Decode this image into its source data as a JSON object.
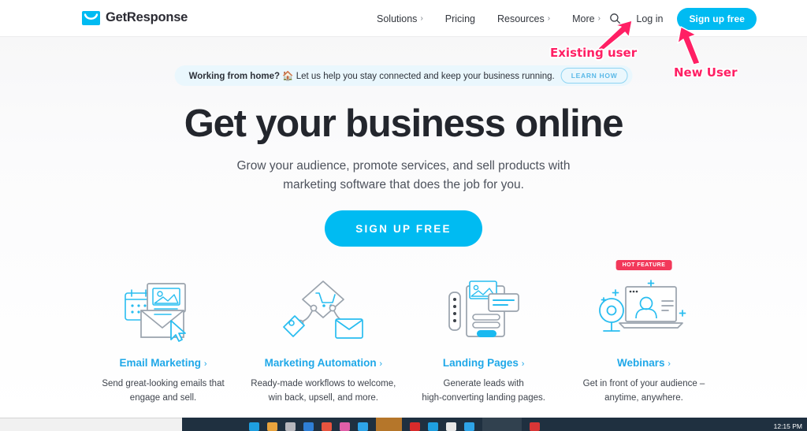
{
  "header": {
    "logo_text": "GetResponse",
    "logo_icon": "envelope-icon",
    "nav": [
      {
        "label": "Solutions",
        "chevron": "›"
      },
      {
        "label": "Pricing",
        "chevron": ""
      },
      {
        "label": "Resources",
        "chevron": "›"
      },
      {
        "label": "More",
        "chevron": "›"
      }
    ],
    "search_icon": "search-icon",
    "login_label": "Log in",
    "signup_label": "Sign up free",
    "accent_color": "#00bbf2"
  },
  "banner": {
    "text_bold": "Working from home?",
    "emoji": "🏠",
    "text_rest": "Let us help you stay connected and keep your business running.",
    "button_label": "LEARN HOW",
    "background": "#eaf7fd"
  },
  "hero": {
    "title": "Get your business online",
    "subtitle_line1": "Grow your audience, promote services, and sell products with",
    "subtitle_line2": "marketing software that does the job for you.",
    "cta_label": "SIGN UP FREE"
  },
  "features": [
    {
      "icon": "email-envelope-image-icon",
      "title": "Email Marketing",
      "chevron": "›",
      "desc_line1": "Send great-looking emails that",
      "desc_line2": "engage and sell.",
      "badge": null
    },
    {
      "icon": "automation-workflow-icon",
      "title": "Marketing Automation",
      "chevron": "›",
      "desc_line1": "Ready-made workflows to welcome,",
      "desc_line2": "win back, upsell, and more.",
      "badge": null
    },
    {
      "icon": "landing-page-builder-icon",
      "title": "Landing Pages",
      "chevron": "›",
      "desc_line1": "Generate leads with",
      "desc_line2": "high-converting landing pages.",
      "badge": null
    },
    {
      "icon": "webinar-laptop-camera-icon",
      "title": "Webinars",
      "chevron": "›",
      "desc_line1": "Get in front of your audience –",
      "desc_line2": "anytime, anywhere.",
      "badge": "HOT FEATURE"
    }
  ],
  "annotations": {
    "color": "#ff1f64",
    "existing_user": "Existing user",
    "new_user": "New User"
  },
  "taskbar": {
    "clock": "12:15 PM"
  }
}
